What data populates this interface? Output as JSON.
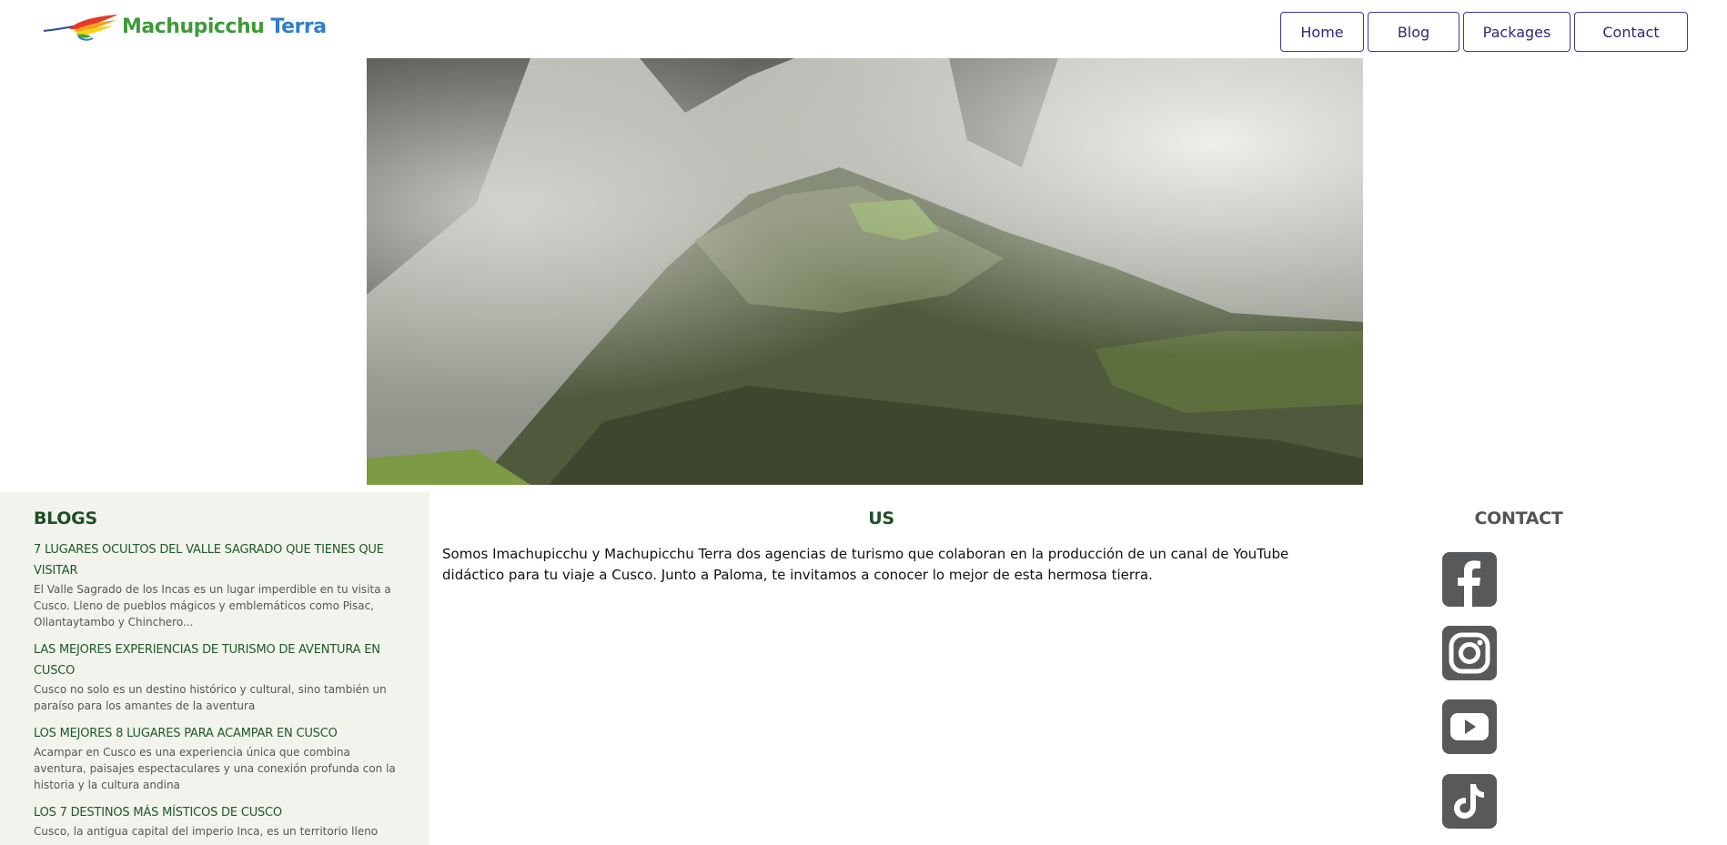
{
  "header": {
    "logo": {
      "word1": "Machupicchu",
      "word2": "Terra"
    },
    "nav": [
      {
        "label": "Home"
      },
      {
        "label": "Blog"
      },
      {
        "label": "Packages"
      },
      {
        "label": "Contact"
      }
    ]
  },
  "hero": {
    "icon": "machu-picchu-photo"
  },
  "blogs": {
    "title": "BLOGS",
    "items": [
      {
        "title": "7 LUGARES OCULTOS DEL VALLE SAGRADO QUE TIENES QUE VISITAR",
        "desc": "El Valle Sagrado de los Incas es un lugar imperdible en tu visita a Cusco. Lleno de pueblos mágicos y emblemáticos como Pisac, Ollantaytambo y Chinchero..."
      },
      {
        "title": "LAS MEJORES EXPERIENCIAS DE TURISMO DE AVENTURA EN CUSCO",
        "desc": "Cusco no solo es un destino histórico y cultural, sino también un paraíso para los amantes de la aventura"
      },
      {
        "title": "LOS MEJORES 8 LUGARES PARA ACAMPAR EN CUSCO",
        "desc": "Acampar en Cusco es una experiencia única que combina aventura, paisajes espectaculares y una conexión profunda con la historia y la cultura andina"
      },
      {
        "title": "LOS 7 DESTINOS MÁS MÍSTICOS DE CUSCO",
        "desc": "Cusco, la antigua capital del imperio Inca, es un territorio lleno"
      }
    ]
  },
  "us": {
    "title": "US",
    "text": "Somos Imachupicchu y Machupicchu Terra dos agencias de turismo que colaboran en la producción de un canal de YouTube didáctico para tu viaje a Cusco. Junto a Paloma, te invitamos a conocer lo mejor de esta hermosa tierra."
  },
  "contact": {
    "title": "CONTACT",
    "social": [
      "facebook-icon",
      "instagram-icon",
      "youtube-icon",
      "tiktok-icon"
    ],
    "icon_color": "#58595b"
  },
  "colors": {
    "nav_border": "#3b3a9a",
    "section_title": "#1f4f25",
    "blog_title": "#1d5a24",
    "blogs_bg": "#f3f3ee"
  }
}
